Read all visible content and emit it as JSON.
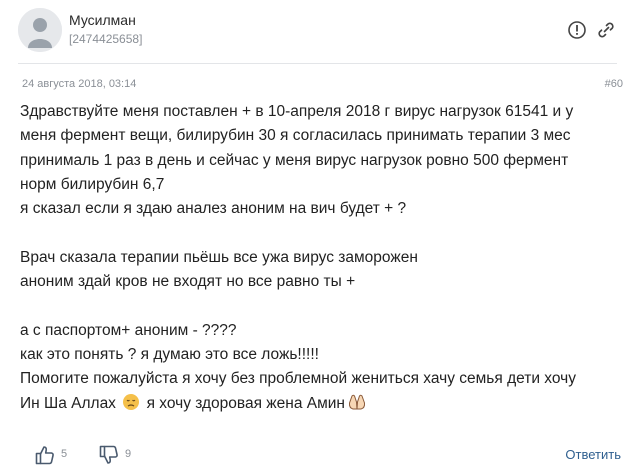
{
  "post": {
    "author": {
      "name": "Мусилман",
      "id": "[2474425658]"
    },
    "date": "24 августа 2018, 03:14",
    "number": "#60",
    "lines": [
      "Здравствуйте меня поставлен + в 10-апреля 2018 г вирус нагрузок 61541 и у",
      "меня фермент вещи, билирубин 30 я согласилась принимать терапии 3 мес",
      "принималь 1 раз в день и сейчас у меня вирус нагрузок ровно 500 фермент",
      "норм билирубин 6,7",
      "я сказал если я здаю аналез аноним на вич будет + ?",
      "",
      "Врач сказала терапии пьёшь все ужа вирус заморожен",
      "аноним здай кров не входят но все равно ты +",
      "",
      "а с паспортом+ аноним - ????",
      "как это понять ? я думаю это все ложь!!!!!",
      "Помогите пожалуйста я хочу без проблемной жениться хачу семья дети хочу"
    ],
    "last_line": {
      "part1": "Ин Ша Аллах",
      "part2": "я хочу здоровая жена Амин"
    },
    "icons": {
      "report": "exclamation-circle-icon",
      "link": "paperclip-link-icon",
      "like": "thumbs-up-icon",
      "dislike": "thumbs-down-icon",
      "emoji1": "disappointed-face-emoji",
      "emoji2": "praying-hands-emoji"
    }
  },
  "footer": {
    "likes": "5",
    "dislikes": "9",
    "reply_label": "Ответить"
  },
  "colors": {
    "link": "#2f5f8f",
    "muted": "#8a8f96",
    "emoji_face": "#f5c04a"
  }
}
